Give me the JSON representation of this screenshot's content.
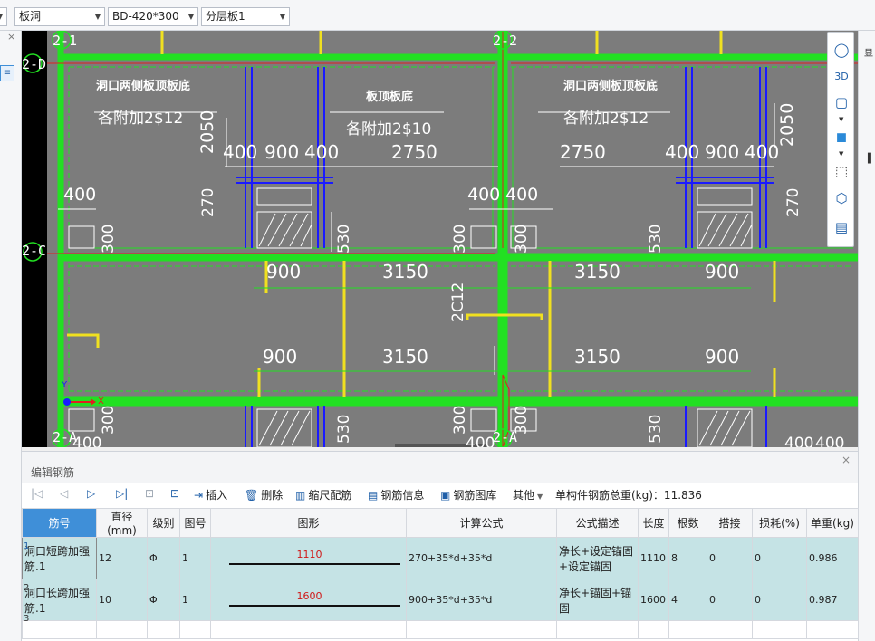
{
  "toolbar_top": {
    "type_select": "板洞",
    "name_select": "BD-420*300",
    "layer_select": "分层板1"
  },
  "canvas": {
    "axis_labels": [
      "2-1",
      "2-2",
      "2-D",
      "2-C",
      "2-A",
      "2-A"
    ],
    "rebar_text": [
      "洞口两侧板顶板底",
      "各附加2$12",
      "板顶板底",
      "各附加2$10",
      "洞口两侧板顶板底",
      "各附加2$12",
      "2C12",
      "X",
      "Y"
    ],
    "dimensions": [
      "2050",
      "400",
      "900",
      "400",
      "2750",
      "2750",
      "400",
      "900",
      "400",
      "2050",
      "400",
      "270",
      "300",
      "530",
      "300",
      "400",
      "400",
      "530",
      "270",
      "300",
      "900",
      "3150",
      "3150",
      "900",
      "900",
      "3150",
      "3150",
      "900",
      "300",
      "530",
      "300",
      "400",
      "400",
      "530",
      "300",
      "400",
      "400"
    ]
  },
  "editor": {
    "title": "编辑钢筋",
    "close": "×",
    "toolbar": {
      "insert": "插入",
      "delete": "删除",
      "scale": "缩尺配筋",
      "info": "钢筋信息",
      "library": "钢筋图库",
      "other": "其他",
      "total_weight": "单构件钢筋总重(kg)：11.836"
    },
    "columns": [
      "筋号",
      "直径(mm)",
      "级别",
      "图号",
      "图形",
      "计算公式",
      "公式描述",
      "长度",
      "根数",
      "搭接",
      "损耗(%)",
      "单重(kg)"
    ],
    "rows": [
      {
        "num": "1",
        "name": "洞口短跨加强筋.1",
        "diameter": "12",
        "grade": "Φ",
        "fig": "1",
        "shape_len": "1110",
        "formula": "270+35*d+35*d",
        "desc": "净长+设定锚固+设定锚固",
        "length": "1110",
        "count": "8",
        "lap": "0",
        "loss": "0",
        "weight": "0.986"
      },
      {
        "num": "2",
        "name": "洞口长跨加强筋.1",
        "diameter": "10",
        "grade": "Φ",
        "fig": "1",
        "shape_len": "1600",
        "formula": "900+35*d+35*d",
        "desc": "净长+锚固+锚固",
        "length": "1600",
        "count": "4",
        "lap": "0",
        "loss": "0",
        "weight": "0.987"
      },
      {
        "num": "3"
      }
    ]
  },
  "colors": {
    "wall": "#22e022",
    "beam": "#f0e020",
    "rebar_blue": "#1a1aff",
    "axis_red": "#e02020",
    "slab": "#7c7c7c",
    "header_active": "#3f8fd8",
    "row_bg": "#c5e3e5"
  }
}
